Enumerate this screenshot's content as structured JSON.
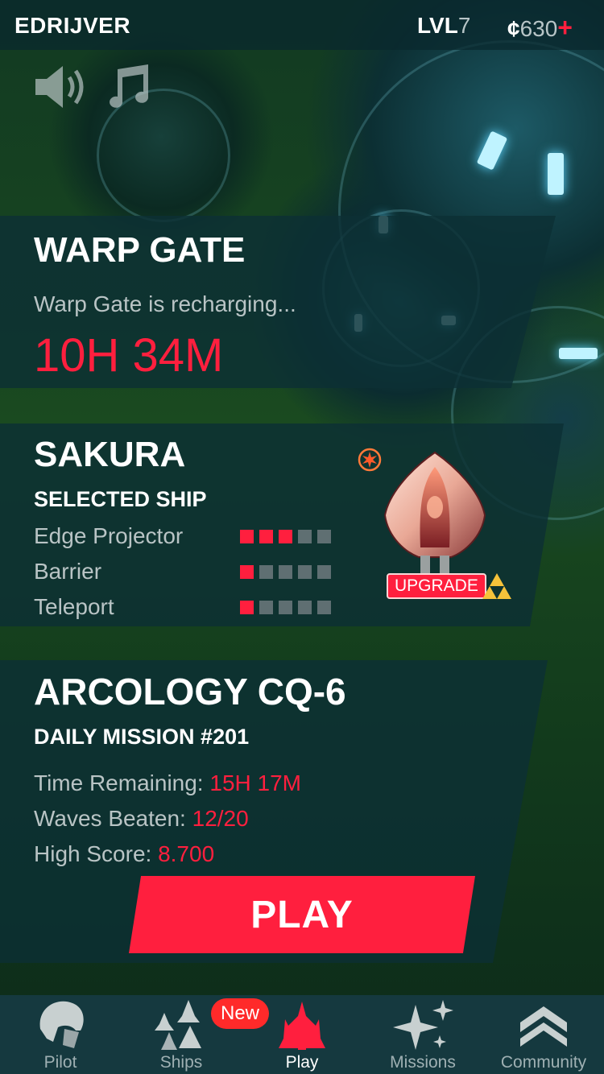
{
  "header": {
    "username": "EDRIJVER",
    "level_prefix": "LVL",
    "level_value": "7",
    "currency_symbol": "¢",
    "currency_value": "630",
    "add_symbol": "+"
  },
  "audio": {
    "sound_icon": "speaker-icon",
    "music_icon": "music-note-icon"
  },
  "warp_gate": {
    "title": "WARP GATE",
    "status": "Warp Gate is recharging...",
    "timer": "10H 34M"
  },
  "ship": {
    "name": "SAKURA",
    "label": "SELECTED SHIP",
    "stats": [
      {
        "label": "Edge Projector",
        "level": 3,
        "max": 5
      },
      {
        "label": "Barrier",
        "level": 1,
        "max": 5
      },
      {
        "label": "Teleport",
        "level": 1,
        "max": 5
      }
    ],
    "upgrade_label": "UPGRADE"
  },
  "mission": {
    "title": "ARCOLOGY CQ-6",
    "subtitle": "DAILY MISSION #201",
    "time_label": "Time Remaining:",
    "time_value": "15H 17M",
    "waves_label": "Waves Beaten:",
    "waves_value": "12/20",
    "score_label": "High Score:",
    "score_value": "8.700",
    "play_label": "PLAY"
  },
  "tabs": [
    {
      "label": "Pilot",
      "icon": "pilot-helmet-icon",
      "active": false
    },
    {
      "label": "Ships",
      "icon": "ships-fleet-icon",
      "active": false,
      "badge": "New"
    },
    {
      "label": "Play",
      "icon": "ship-play-icon",
      "active": true
    },
    {
      "label": "Missions",
      "icon": "stars-icon",
      "active": false
    },
    {
      "label": "Community",
      "icon": "chevron-rank-icon",
      "active": false
    }
  ],
  "colors": {
    "accent": "#ff1f3e",
    "panel": "#0c3034",
    "muted_text": "#b9c4c5"
  }
}
